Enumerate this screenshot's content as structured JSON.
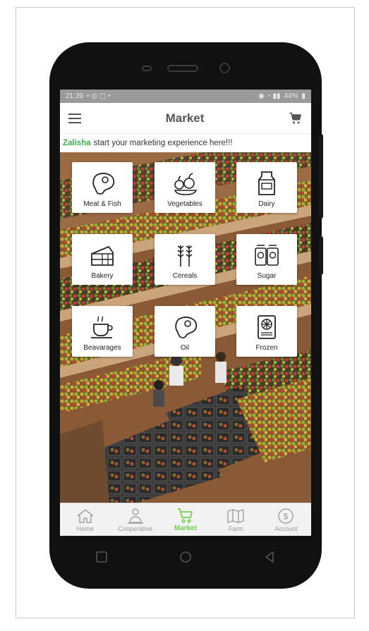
{
  "status_bar": {
    "time": "21:39",
    "battery": "44%"
  },
  "app_bar": {
    "title": "Market",
    "menu_icon": "hamburger-menu-icon",
    "cart_icon": "shopping-cart-icon"
  },
  "welcome": {
    "user": "Zalisha",
    "message": "start your marketing experience here!!!"
  },
  "categories": [
    {
      "label": "Meat & Fish",
      "icon": "steak-icon"
    },
    {
      "label": "Vegetables",
      "icon": "vegetables-icon"
    },
    {
      "label": "Dairy",
      "icon": "milk-carton-icon"
    },
    {
      "label": "Bakery",
      "icon": "cake-icon"
    },
    {
      "label": "Cereals",
      "icon": "wheat-icon"
    },
    {
      "label": "Sugar",
      "icon": "sugar-jars-icon"
    },
    {
      "label": "Beavarages",
      "icon": "coffee-cup-icon"
    },
    {
      "label": "Oil",
      "icon": "steak-icon"
    },
    {
      "label": "Frozen",
      "icon": "freezer-icon"
    }
  ],
  "bottom_nav": [
    {
      "label": "Home",
      "icon": "home-icon",
      "active": false
    },
    {
      "label": "Cooperative",
      "icon": "people-icon",
      "active": false
    },
    {
      "label": "Market",
      "icon": "cart-icon",
      "active": true
    },
    {
      "label": "Farm",
      "icon": "map-icon",
      "active": false
    },
    {
      "label": "Account",
      "icon": "dollar-coin-icon",
      "active": false
    }
  ],
  "colors": {
    "accent_green": "#6fd24c",
    "username_green": "#3cb043",
    "status_bar": "#9a9a9a"
  }
}
